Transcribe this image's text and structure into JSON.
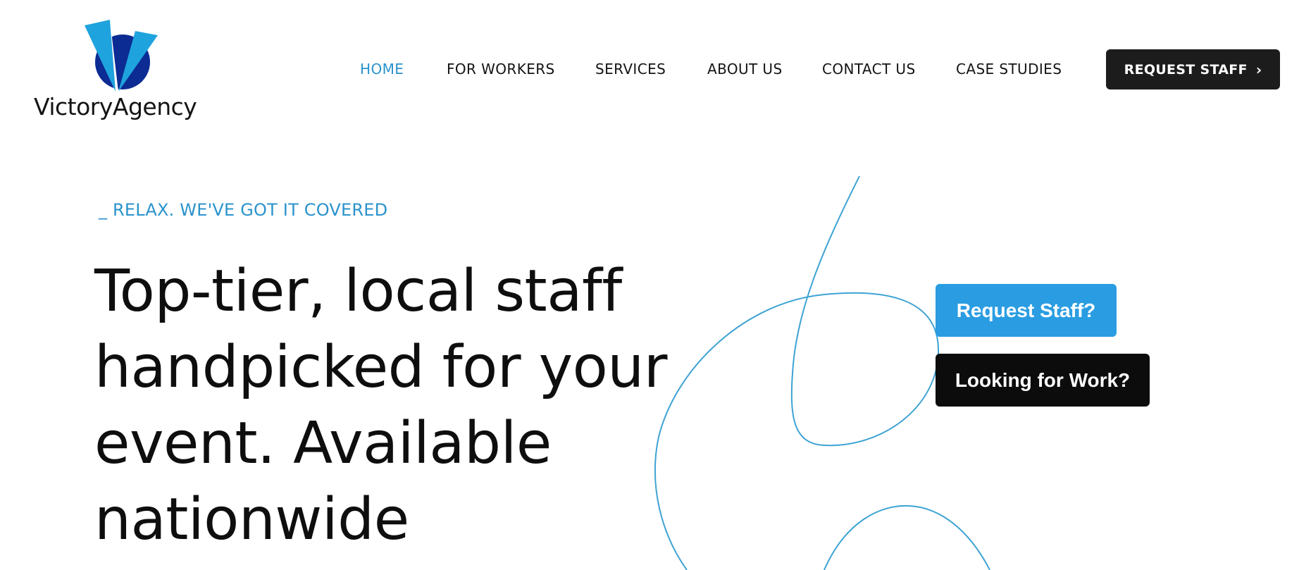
{
  "brand": {
    "name": "VictoryAgency",
    "logo_icon": "victory-v-logo",
    "colors": {
      "accent": "#2b93cc",
      "logo_light": "#1fa3de",
      "logo_dark": "#0c2b93",
      "button_blue": "#2a9de2",
      "button_dark": "#1c1c1c"
    }
  },
  "nav": {
    "items": [
      {
        "label": "HOME",
        "active": true
      },
      {
        "label": "FOR WORKERS",
        "active": false
      },
      {
        "label": "SERVICES",
        "active": false
      },
      {
        "label": "ABOUT US",
        "active": false
      },
      {
        "label": "CONTACT US",
        "active": false
      },
      {
        "label": "CASE STUDIES",
        "active": false
      }
    ],
    "cta_label": "REQUEST STAFF",
    "cta_icon": "chevron-right-icon"
  },
  "hero": {
    "tagline": "_ RELAX. WE'VE GOT IT COVERED",
    "headline_lines": [
      "Top-tier, local staff",
      "handpicked for your",
      "event. Available",
      "nationwide"
    ],
    "buttons": {
      "request_staff": "Request Staff?",
      "looking_for_work": "Looking for Work?"
    }
  }
}
